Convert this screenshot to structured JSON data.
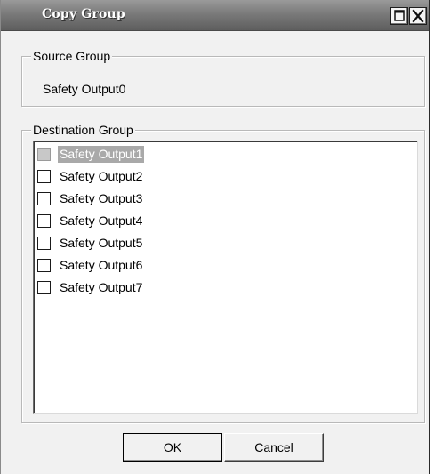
{
  "window": {
    "title": "Copy Group",
    "maximize_icon": "maximize-icon",
    "close_icon": "close-icon"
  },
  "source_group": {
    "legend": "Source Group",
    "value": "Safety Output0"
  },
  "destination_group": {
    "legend": "Destination Group",
    "items": [
      {
        "label": "Safety Output1",
        "checked": false,
        "disabled": true,
        "selected": true
      },
      {
        "label": "Safety Output2",
        "checked": false,
        "disabled": false,
        "selected": false
      },
      {
        "label": "Safety Output3",
        "checked": false,
        "disabled": false,
        "selected": false
      },
      {
        "label": "Safety Output4",
        "checked": false,
        "disabled": false,
        "selected": false
      },
      {
        "label": "Safety Output5",
        "checked": false,
        "disabled": false,
        "selected": false
      },
      {
        "label": "Safety Output6",
        "checked": false,
        "disabled": false,
        "selected": false
      },
      {
        "label": "Safety Output7",
        "checked": false,
        "disabled": false,
        "selected": false
      }
    ]
  },
  "buttons": {
    "ok_label": "OK",
    "cancel_label": "Cancel"
  },
  "colors": {
    "title_bar": "#7a7a7a",
    "selection": "#a9a9a9",
    "dialog_background": "#f1f1f1"
  }
}
